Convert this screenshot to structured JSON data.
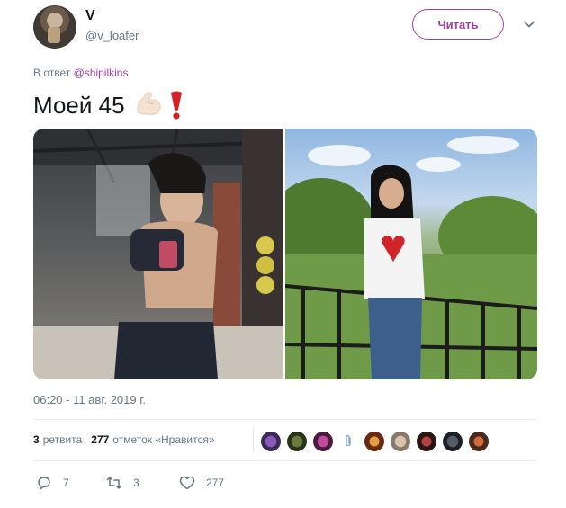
{
  "author": {
    "display_name": "V",
    "username": "@v_loafer",
    "follow_label": "Читать"
  },
  "reply": {
    "prefix": "В ответ",
    "mention": "@shipilkins"
  },
  "tweet": {
    "text": "Моей 45",
    "emojis": [
      "flexed-biceps-icon",
      "exclamation-mark-icon"
    ]
  },
  "media": {
    "photos": [
      "gym-selfie-photo",
      "park-railing-photo"
    ]
  },
  "timestamp": "06:20 - 11 авг. 2019 г.",
  "stats": {
    "retweets_count": "3",
    "retweets_label": "ретвита",
    "likes_count": "277",
    "likes_label": "отметок «Нравится»"
  },
  "actions": {
    "replies": "7",
    "retweets": "3",
    "likes": "277"
  },
  "colors": {
    "accent": "#a1409f",
    "muted": "#657786",
    "text": "#14171a",
    "divider": "#e6ecf0",
    "heart_red": "#d1232a"
  }
}
